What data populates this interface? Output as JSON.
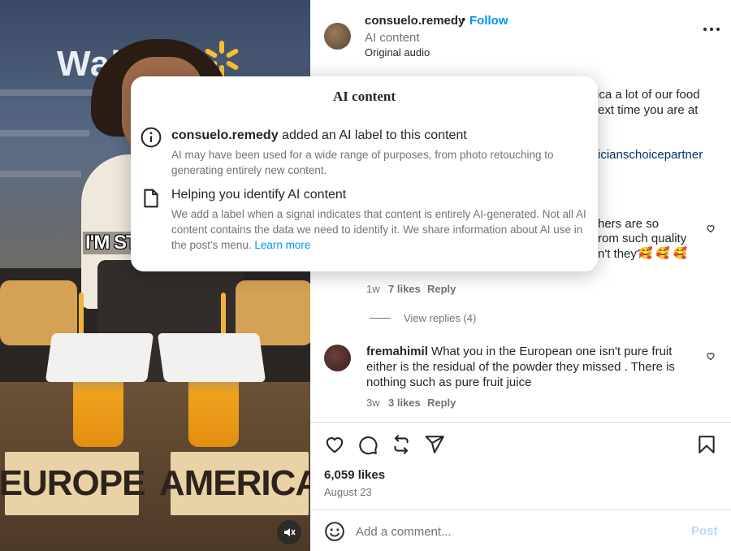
{
  "video": {
    "store_sign": "Wal",
    "overlay_caption": "I'M ST",
    "sign_left": "EUROPE",
    "sign_right": "AMERICA"
  },
  "header": {
    "username": "consuelo.remedy",
    "separator": "•",
    "follow_label": "Follow",
    "ai_label": "AI content",
    "audio": "Original audio"
  },
  "caption_fragments": {
    "line1": "ica a lot of our food",
    "line2": "ext time you are at",
    "hashtag": "icianschoicepartner"
  },
  "comment1": {
    "line1": "hers are so",
    "line2": "rom such quality",
    "line3": "n't they?",
    "emoji_tail": "🥰 🥰 🥰",
    "time": "1w",
    "likes": "7 likes",
    "reply": "Reply",
    "view_replies": "View replies (4)"
  },
  "comment2": {
    "username": "fremahimil",
    "text": "What you in the European one isn't pure fruit either is the residual of the powder they missed . There is nothing such as pure fruit juice",
    "time": "3w",
    "likes": "3 likes",
    "reply": "Reply"
  },
  "post": {
    "likes": "6,059 likes",
    "date": "August 23"
  },
  "composer": {
    "placeholder": "Add a comment...",
    "post_label": "Post"
  },
  "modal": {
    "title": "AI content",
    "section1": {
      "username": "consuelo.remedy",
      "heading_rest": " added an AI label to this content",
      "body": "AI may have been used for a wide range of purposes, from photo retouching to generating entirely new content."
    },
    "section2": {
      "heading": "Helping you identify AI content",
      "body": "We add a label when a signal indicates that content is entirely AI-generated. Not all AI content contains the data we need to identify it. We share information about AI use in the post's menu. ",
      "learn_more": "Learn more"
    }
  },
  "colors": {
    "link_blue": "#0095f6",
    "hashtag_blue": "#00376b",
    "text_primary": "#262626",
    "text_secondary": "#737373"
  }
}
